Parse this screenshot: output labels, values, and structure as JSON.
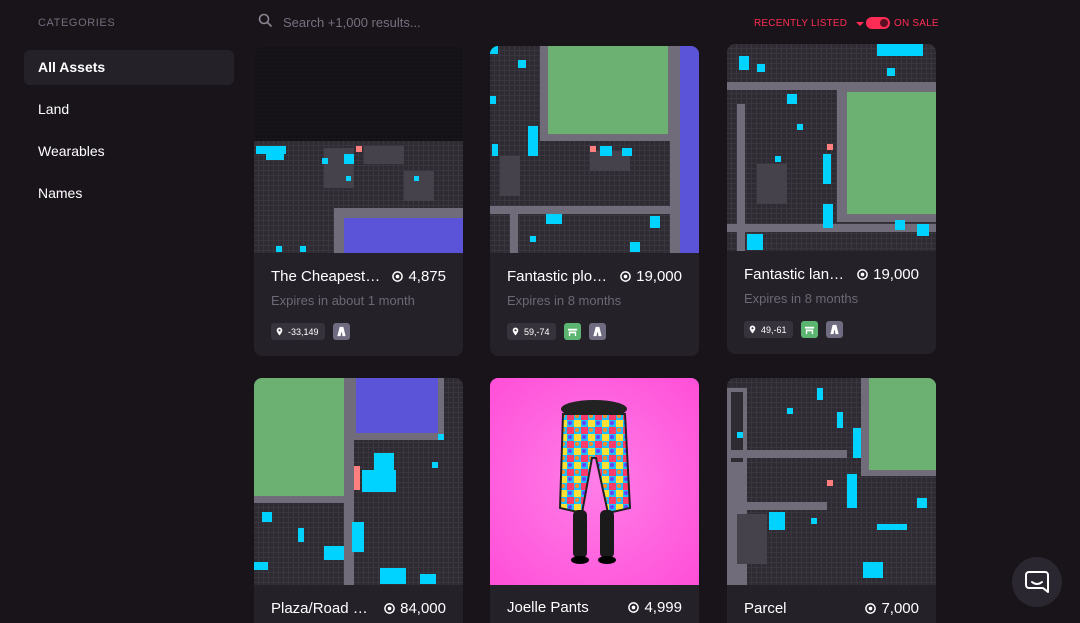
{
  "sidebar": {
    "title": "CATEGORIES",
    "items": [
      {
        "label": "All Assets",
        "active": true
      },
      {
        "label": "Land"
      },
      {
        "label": "Wearables"
      },
      {
        "label": "Names"
      }
    ]
  },
  "search": {
    "placeholder": "Search +1,000 results..."
  },
  "sort": {
    "label": "RECENTLY LISTED"
  },
  "on_sale": {
    "label": "ON SALE",
    "enabled": true
  },
  "cards": [
    {
      "name": "The Cheapest…",
      "price": "4,875",
      "expiry": "Expires in about 1 month",
      "coords": "-33,149",
      "tags": [
        "road-icon"
      ],
      "thumb": "land-map-1"
    },
    {
      "name": "Fantastic plo…",
      "price": "19,000",
      "expiry": "Expires in 8 months",
      "coords": "59,-74",
      "tags": [
        "plaza-icon",
        "road-icon"
      ],
      "thumb": "land-map-2"
    },
    {
      "name": "Fantastic lan…",
      "price": "19,000",
      "expiry": "Expires in 8 months",
      "coords": "49,-61",
      "tags": [
        "plaza-icon",
        "road-icon"
      ],
      "thumb": "land-map-3"
    },
    {
      "name": "Plaza/Road …",
      "price": "84,000",
      "thumb": "land-map-4"
    },
    {
      "name": "Joelle Pants",
      "price": "4,999",
      "thumb": "wearable-pants"
    },
    {
      "name": "Parcel",
      "price": "7,000",
      "thumb": "land-map-5"
    }
  ],
  "colors": {
    "background": "#18141a",
    "card": "#242129",
    "accent": "#ff2d55",
    "map_bg": "#3a3640",
    "map_plaza": "#6cb072",
    "map_road": "#706c7a",
    "map_district": "#5b54d8",
    "map_owned": "#00d3ff",
    "wearable_bg": "#ff5fe0"
  },
  "chat": {
    "icon": "chat-bubble-icon"
  }
}
